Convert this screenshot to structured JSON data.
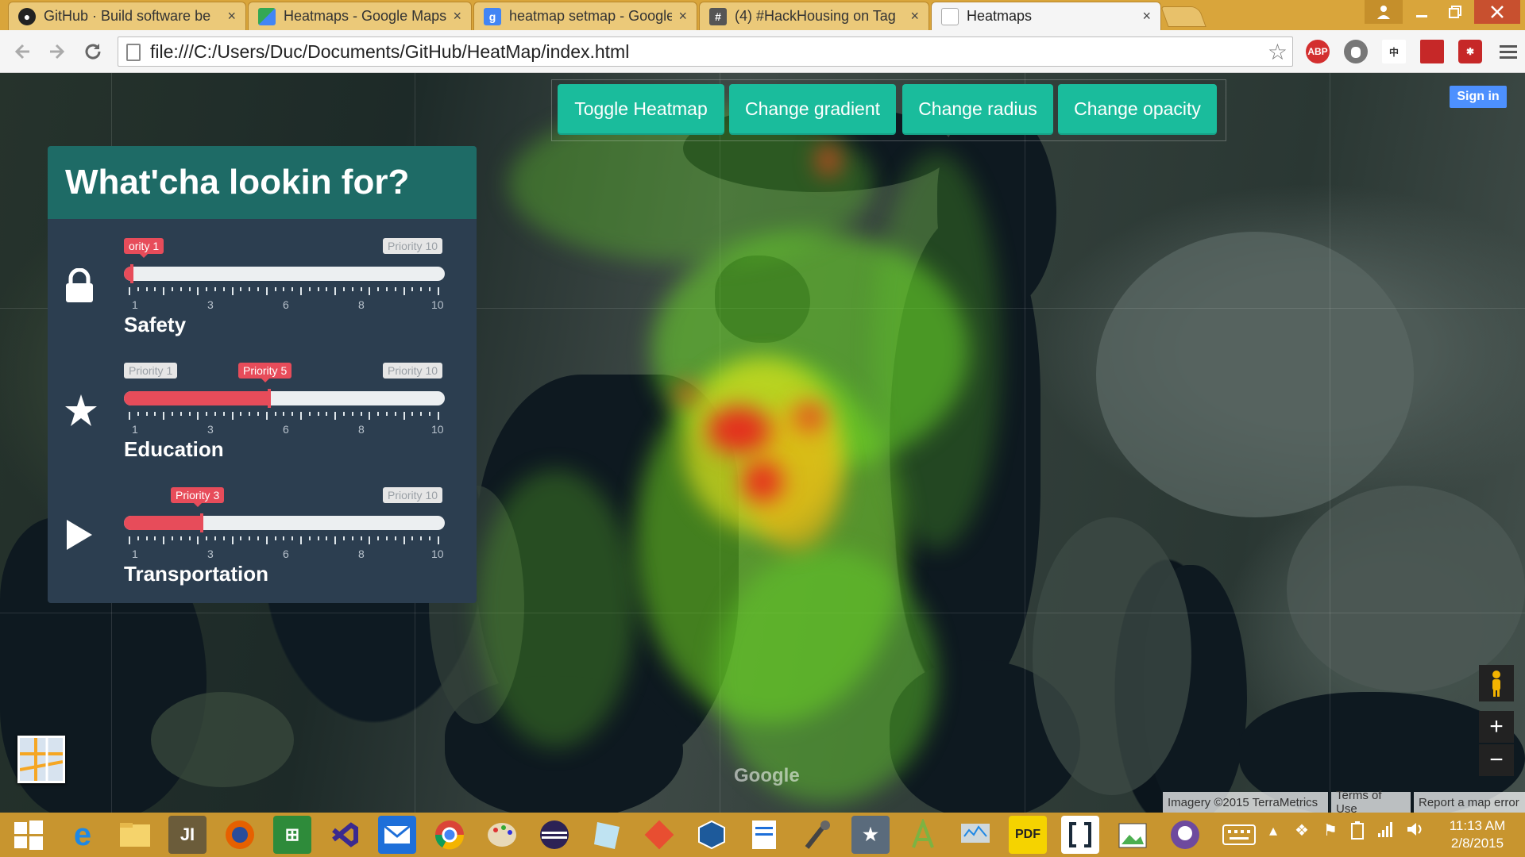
{
  "browser": {
    "tabs": [
      {
        "title": "GitHub · Build software be",
        "favicon": "github-icon"
      },
      {
        "title": "Heatmaps - Google Maps",
        "favicon": "google-maps-icon"
      },
      {
        "title": "heatmap setmap - Google",
        "favicon": "google-search-icon"
      },
      {
        "title": "(4) #HackHousing on Tag",
        "favicon": "hashtag-icon"
      },
      {
        "title": "Heatmaps",
        "favicon": "page-icon"
      }
    ],
    "active_tab": 4,
    "close_glyph": "×",
    "url": "file:///C:/Users/Duc/Documents/GitHub/HeatMap/index.html",
    "extensions": [
      {
        "name": "adblock-plus-icon",
        "label": "ABP",
        "color": "#d32f2f"
      },
      {
        "name": "hand-extension-icon",
        "label": "",
        "color": "#777777"
      },
      {
        "name": "translate-extension-icon",
        "label": "中",
        "color": "#444444"
      },
      {
        "name": "bookmark-extension-icon",
        "label": "",
        "color": "#c62828"
      },
      {
        "name": "lastpass-icon",
        "label": "✱",
        "color": "#c62828"
      }
    ]
  },
  "map_controls": {
    "buttons": [
      "Toggle Heatmap",
      "Change gradient",
      "Change radius",
      "Change opacity"
    ],
    "sign_in": "Sign in",
    "zoom_in": "+",
    "zoom_out": "−",
    "google_logo": "Google",
    "attribution": [
      "Imagery ©2015 TerraMetrics",
      "Terms of Use",
      "Report a map error"
    ]
  },
  "panel": {
    "title": "What'cha lookin for?",
    "min_tip": "Priority 1",
    "max_tip": "Priority 10",
    "tick_labels": [
      "1",
      "3",
      "6",
      "8",
      "10"
    ],
    "rows": [
      {
        "label": "Safety",
        "icon": "lock-icon",
        "value": 1,
        "value_tip": "ority 1"
      },
      {
        "label": "Education",
        "icon": "star-icon",
        "value": 5,
        "value_tip": "Priority 5"
      },
      {
        "label": "Transportation",
        "icon": "play-icon",
        "value": 3,
        "value_tip": "Priority 3"
      }
    ],
    "accent_color": "#e74c5a",
    "header_color": "#1e6b66",
    "panel_color": "#2c3e50"
  },
  "colors": {
    "button_teal": "#1abc9c",
    "taskbar": "#c8952f",
    "tabbar": "#d9a53b"
  },
  "taskbar": {
    "time": "11:13 AM",
    "date": "2/8/2015",
    "apps": [
      "windows-start-icon",
      "internet-explorer-icon",
      "file-explorer-icon",
      "jetbrains-icon",
      "firefox-icon",
      "windows-store-icon",
      "visual-studio-icon",
      "mail-icon",
      "chrome-icon",
      "paint-icon",
      "eclipse-icon",
      "notepad-icon",
      "git-icon",
      "virtualbox-icon",
      "wordpad-icon",
      "microphone-icon",
      "settings-star-icon",
      "android-studio-icon",
      "monitor-icon",
      "pdf-icon",
      "brackets-icon",
      "image-editor-icon",
      "github-desktop-icon"
    ]
  }
}
